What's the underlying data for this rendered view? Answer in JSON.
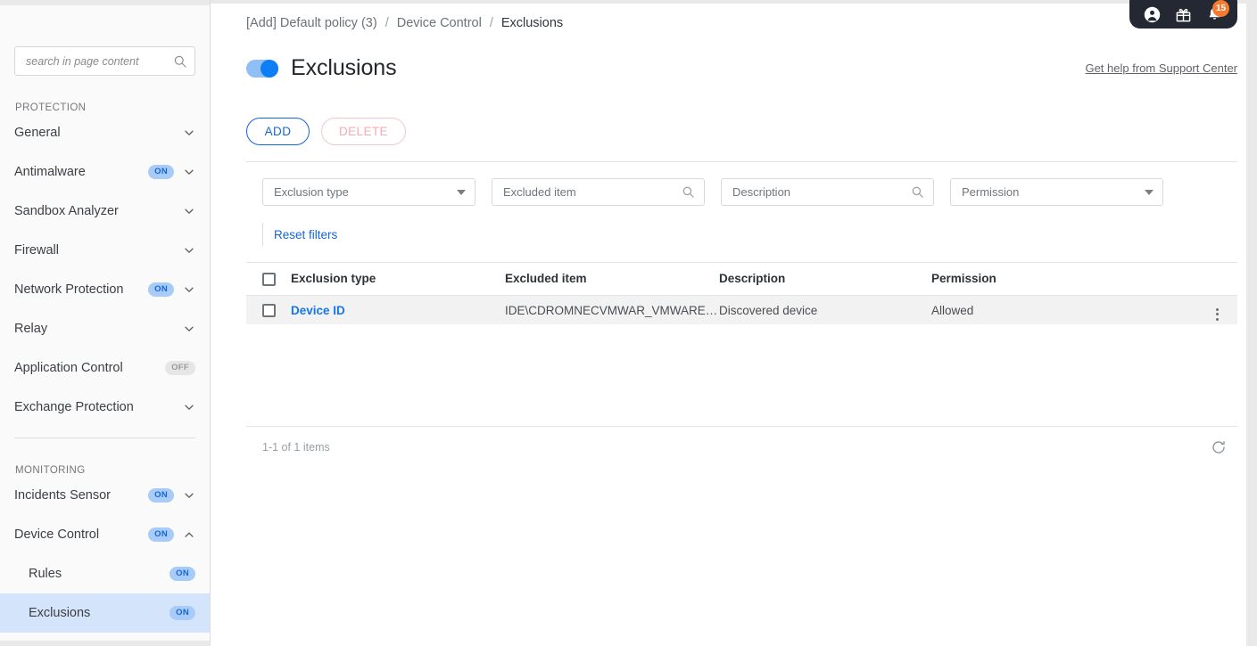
{
  "sidebar": {
    "search": {
      "placeholder": "search in page content",
      "value": ""
    },
    "sections": [
      {
        "label": "PROTECTION",
        "items": [
          {
            "label": "General",
            "badge": null,
            "chevron": "down"
          },
          {
            "label": "Antimalware",
            "badge": "ON",
            "chevron": "down"
          },
          {
            "label": "Sandbox Analyzer",
            "badge": null,
            "chevron": "down"
          },
          {
            "label": "Firewall",
            "badge": null,
            "chevron": "down"
          },
          {
            "label": "Network Protection",
            "badge": "ON",
            "chevron": "down"
          },
          {
            "label": "Relay",
            "badge": null,
            "chevron": "down"
          },
          {
            "label": "Application Control",
            "badge": "OFF",
            "chevron": null
          },
          {
            "label": "Exchange Protection",
            "badge": null,
            "chevron": "down"
          }
        ]
      },
      {
        "label": "MONITORING",
        "items": [
          {
            "label": "Incidents Sensor",
            "badge": "ON",
            "chevron": "down"
          },
          {
            "label": "Device Control",
            "badge": "ON",
            "chevron": "up"
          },
          {
            "label": "Rules",
            "badge": "ON",
            "chevron": null,
            "sub": true
          },
          {
            "label": "Exclusions",
            "badge": "ON",
            "chevron": null,
            "sub": true,
            "active": true
          }
        ]
      }
    ]
  },
  "topbar": {
    "icons": [
      {
        "name": "account-icon"
      },
      {
        "name": "gift-icon"
      },
      {
        "name": "bell-icon",
        "badge": "15"
      }
    ]
  },
  "breadcrumb": {
    "items": [
      "[Add] Default policy (3)",
      "Device Control",
      "Exclusions"
    ],
    "separator": "/"
  },
  "page": {
    "title": "Exclusions",
    "toggle_on": true,
    "help_link": "Get help from Support Center"
  },
  "toolbar": {
    "add_label": "ADD",
    "delete_label": "DELETE"
  },
  "filters": {
    "exclusion_type": {
      "placeholder": "Exclusion type",
      "value": ""
    },
    "excluded_item": {
      "placeholder": "Excluded item",
      "value": ""
    },
    "description": {
      "placeholder": "Description",
      "value": ""
    },
    "permission": {
      "placeholder": "Permission",
      "value": ""
    },
    "reset_label": "Reset filters"
  },
  "table": {
    "columns": [
      "Exclusion type",
      "Excluded item",
      "Description",
      "Permission"
    ],
    "rows": [
      {
        "exclusion_type": "Device ID",
        "excluded_item": "IDE\\CDROMNECVMWAR_VMWARE_...",
        "description": "Discovered device",
        "permission": "Allowed"
      }
    ]
  },
  "footer": {
    "count": "1-1 of 1 items"
  },
  "colors": {
    "accent_blue": "#1565d8",
    "link_blue": "#1777e8",
    "toggle_on": "#0d7ef5",
    "badge_on_bg": "#a8ccf7",
    "badge_on_text": "#1566d6",
    "active_row": "#d4e4fb",
    "notif_orange": "#f47b32",
    "topbar_dark": "#242833",
    "delete_pink": "#f3acb2"
  }
}
